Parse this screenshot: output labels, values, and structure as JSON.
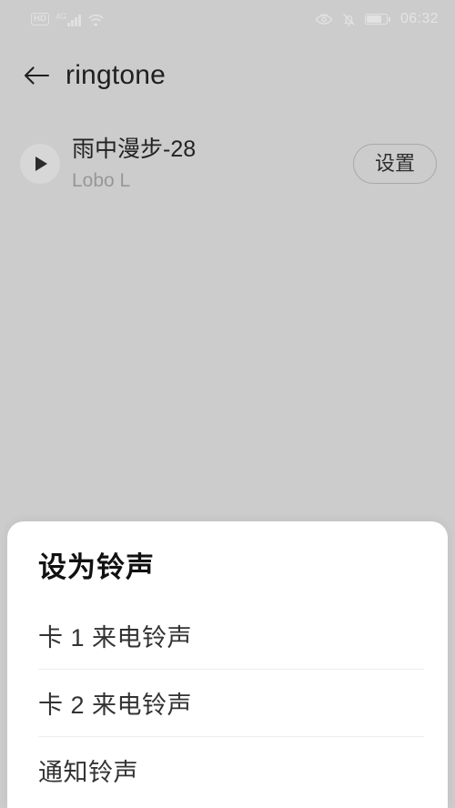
{
  "status_bar": {
    "hd_badge": "HD",
    "network_label": "4G",
    "signal_icon": "signal-bars-icon",
    "wifi_icon": "wifi-icon",
    "eye_comfort_icon": "eye-icon",
    "silent_icon": "bell-muted-icon",
    "battery_icon": "battery-icon",
    "time": "06:32"
  },
  "app_bar": {
    "back_icon": "back-arrow-icon",
    "title": "ringtone"
  },
  "song": {
    "play_icon": "play-icon",
    "title": "雨中漫步-28",
    "artist": "Lobo L",
    "set_button_label": "设置"
  },
  "sheet": {
    "title": "设为铃声",
    "items": [
      {
        "label": "卡 1 来电铃声"
      },
      {
        "label": "卡 2 来电铃声"
      },
      {
        "label": "通知铃声"
      }
    ]
  },
  "colors": {
    "page_background": "#cccccc",
    "sheet_background": "#ffffff",
    "primary_text": "#232323",
    "secondary_text": "#979797",
    "divider": "#ededed",
    "status_icon": "#e2e2e2"
  }
}
